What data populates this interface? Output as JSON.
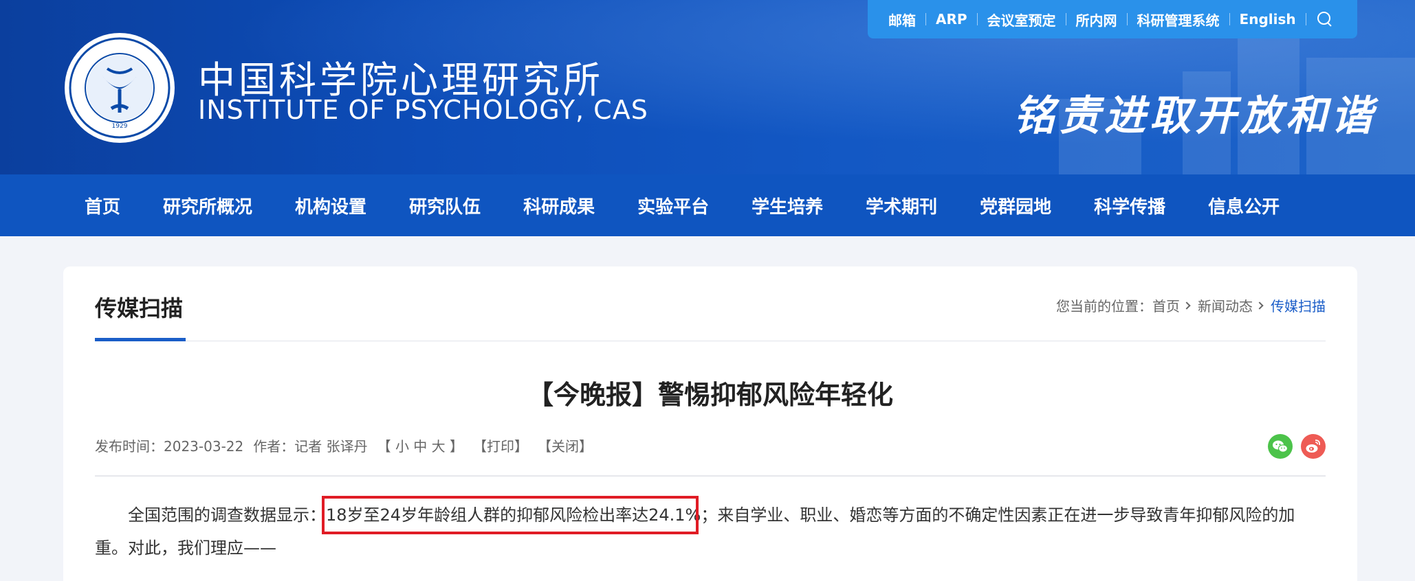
{
  "topbar": {
    "links": [
      "邮箱",
      "ARP",
      "会议室预定",
      "所内网",
      "科研管理系统",
      "English"
    ],
    "search_icon": "search-icon"
  },
  "header": {
    "logo_icon": "institute-seal-logo",
    "logo_year": "1929",
    "name_cn": "中国科学院心理研究所",
    "name_en": "INSTITUTE OF PSYCHOLOGY, CAS",
    "motto": "铭责进取开放和谐"
  },
  "nav": {
    "items": [
      "首页",
      "研究所概况",
      "机构设置",
      "研究队伍",
      "科研成果",
      "实验平台",
      "学生培养",
      "学术期刊",
      "党群园地",
      "科学传播",
      "信息公开"
    ]
  },
  "section": {
    "title": "传媒扫描"
  },
  "breadcrumb": {
    "prefix": "您当前的位置：",
    "items": [
      "首页",
      "新闻动态",
      "传媒扫描"
    ]
  },
  "article": {
    "title": "【今晚报】警惕抑郁风险年轻化",
    "publish_label": "发布时间：2023-03-22",
    "author_label": "作者：记者 张译丹",
    "font_size_label": "【 小 中 大 】",
    "print_label": "【打印】",
    "close_label": "【关闭】",
    "share_icons": [
      "wechat-icon",
      "weibo-icon"
    ],
    "body_intro": "全国范围的调查数据显示：",
    "body_highlight": "18岁至24岁年龄组人群的抑郁风险检出率达24.1%",
    "body_rest": "；来自学业、职业、婚恋等方面的不确定性因素正在进一步导致青年抑郁风险的加重。对此，我们理应——"
  },
  "colors": {
    "header_blue": "#0d4db8",
    "topbar_blue": "#2a91ea",
    "nav_blue": "#0f55c0",
    "accent_blue": "#1a5dc8",
    "highlight_red": "#e01c25"
  }
}
